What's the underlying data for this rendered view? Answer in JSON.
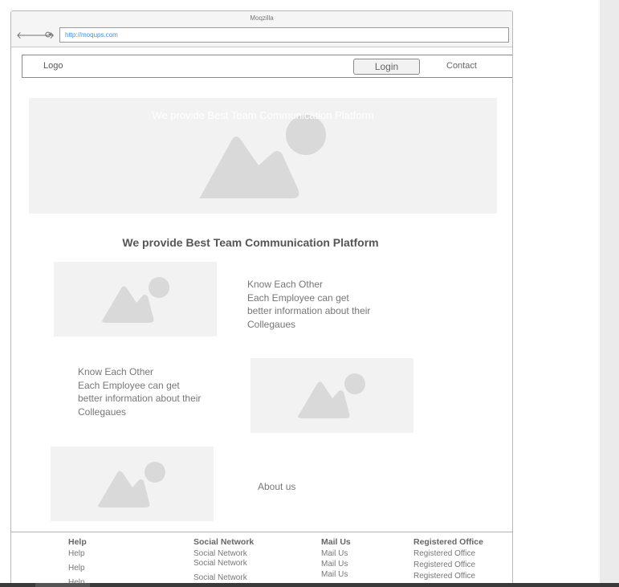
{
  "browser": {
    "window_title": "Moqzilla",
    "url": "http://moqups.com",
    "back_glyph": "🡐",
    "forward_glyph": "🡒",
    "reload_glyph": "⟳"
  },
  "navbar": {
    "logo": "Logo",
    "login": "Login",
    "contact": "Contact"
  },
  "hero": {
    "text": "We provide Best Team Communication Platform"
  },
  "section": {
    "title": "We provide Best Team Communication Platform"
  },
  "features": [
    {
      "line1": "Know Each Other",
      "line2": "Each Employee can get",
      "line3": "better information about their",
      "line4": "Collegaues"
    },
    {
      "line1": "Know Each Other",
      "line2": "Each Employee can get",
      "line3": "better information about their",
      "line4": "Collegaues"
    }
  ],
  "about": {
    "label": "About us"
  },
  "footer": {
    "help": {
      "head": "Help",
      "items": [
        "Help",
        "Help",
        "Help"
      ]
    },
    "social": {
      "head": "Social Network",
      "items": [
        "Social Network",
        "Social Network",
        "Social Network"
      ]
    },
    "mail": {
      "head": "Mail Us",
      "items": [
        "Mail Us",
        "Mail Us",
        "Mail Us"
      ]
    },
    "office": {
      "head": "Registered Office",
      "items": [
        "Registered Office",
        "Registered Office",
        "Registered Office"
      ]
    }
  },
  "icons": {
    "image_placeholder": "mountain-sun-icon"
  },
  "colors": {
    "placeholder_bg": "#f2f2f2",
    "placeholder_shape": "#d9d9d9",
    "url_text": "#4a90d9",
    "right_strip": "#ebebeb"
  }
}
